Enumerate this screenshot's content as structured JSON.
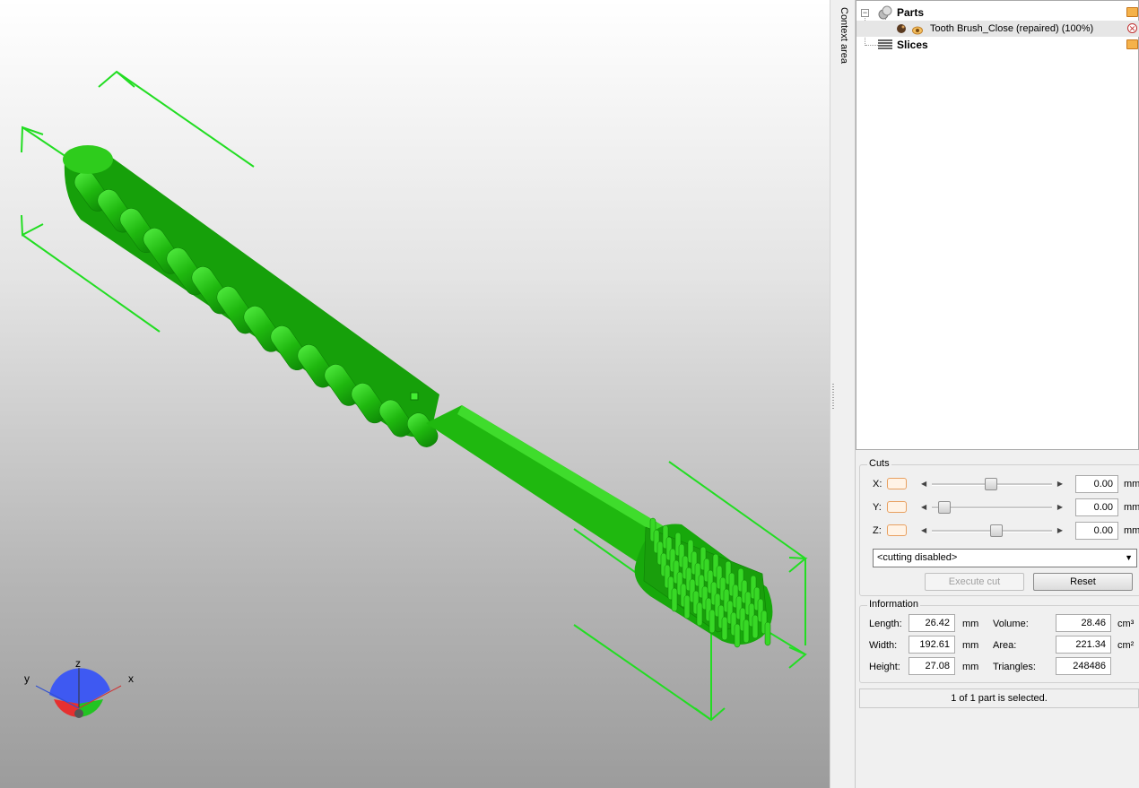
{
  "tree": {
    "parts_label": "Parts",
    "part_name": "Tooth Brush_Close (repaired) (100%)",
    "slices_label": "Slices",
    "expander_symbol": "−"
  },
  "context_tab": "Context area",
  "cuts": {
    "title": "Cuts",
    "x_label": "X:",
    "y_label": "Y:",
    "z_label": "Z:",
    "x_value": "0.00",
    "y_value": "0.00",
    "z_value": "0.00",
    "unit": "mm",
    "mode": "<cutting disabled>",
    "execute_label": "Execute cut",
    "reset_label": "Reset"
  },
  "info": {
    "title": "Information",
    "length_label": "Length:",
    "length_value": "26.42",
    "length_unit": "mm",
    "width_label": "Width:",
    "width_value": "192.61",
    "width_unit": "mm",
    "height_label": "Height:",
    "height_value": "27.08",
    "height_unit": "mm",
    "volume_label": "Volume:",
    "volume_value": "28.46",
    "volume_unit": "cm³",
    "area_label": "Area:",
    "area_value": "221.34",
    "area_unit": "cm²",
    "triangles_label": "Triangles:",
    "triangles_value": "248486"
  },
  "status": "1 of 1 part is selected.",
  "axes": {
    "x": "x",
    "y": "y",
    "z": "z"
  },
  "colors": {
    "model": "#1fbf0e",
    "bbox": "#22dd22"
  }
}
